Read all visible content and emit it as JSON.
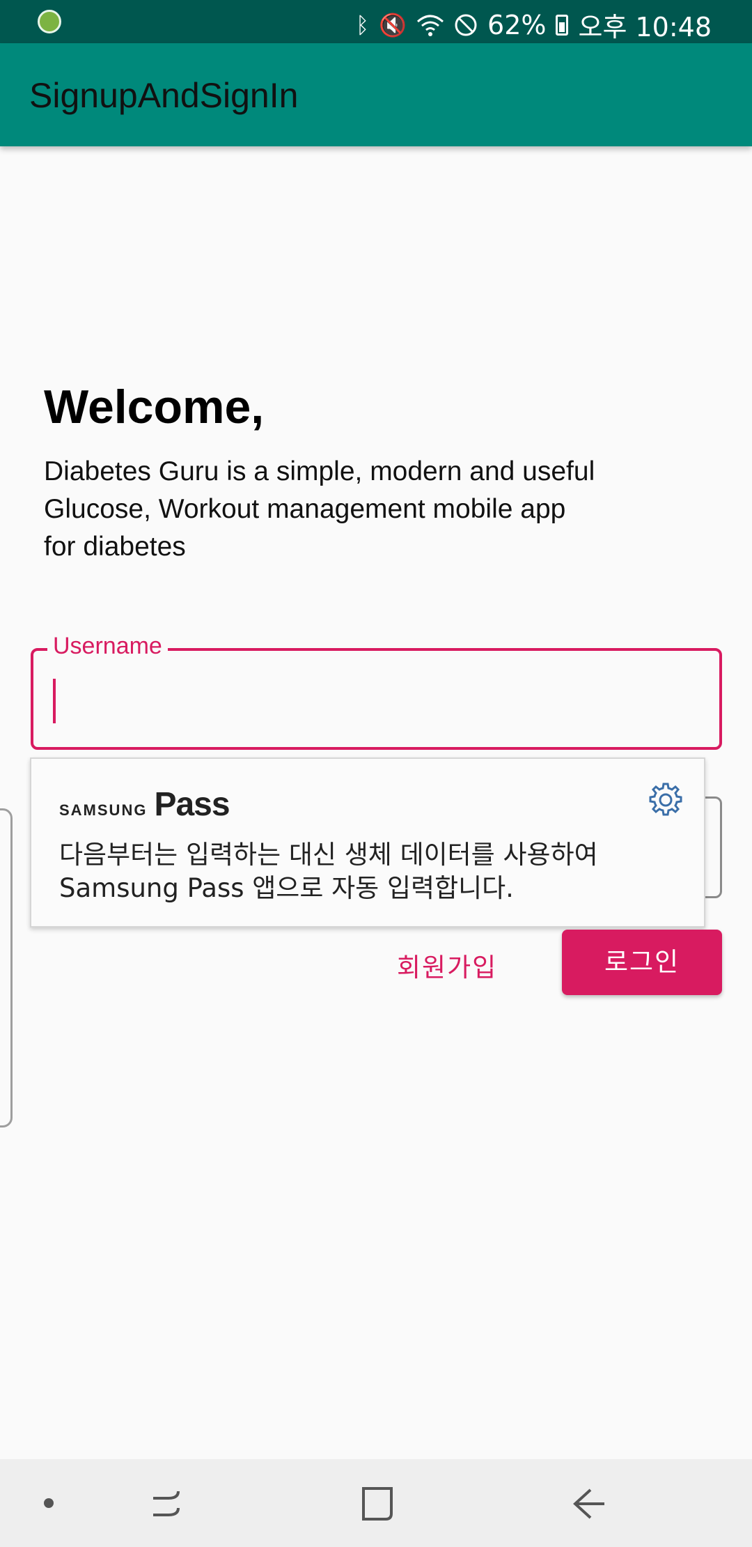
{
  "status_bar": {
    "battery": "62%",
    "time": "오후 10:48",
    "icons": [
      "bluetooth-icon",
      "mute-icon",
      "wifi-icon",
      "do-not-disturb-icon",
      "battery-icon"
    ]
  },
  "app_bar": {
    "title": "SignupAndSignIn"
  },
  "main": {
    "heading": "Welcome,",
    "description_lines": [
      "Diabetes Guru is a simple, modern and useful",
      "Glucose, Workout management mobile app",
      "for diabetes"
    ],
    "username_field": {
      "label": "Username",
      "value": ""
    },
    "signup_label": "회원가입",
    "login_label": "로그인"
  },
  "samsung_pass_popup": {
    "brand_small": "SAMSUNG",
    "brand_large": "Pass",
    "message_lines": [
      "다음부터는 입력하는 대신 생체 데이터를 사용하여",
      "Samsung Pass 앱으로 자동 입력합니다."
    ]
  },
  "colors": {
    "primary": "#00897b",
    "primary_dark": "#00574f",
    "accent": "#d81b60"
  }
}
